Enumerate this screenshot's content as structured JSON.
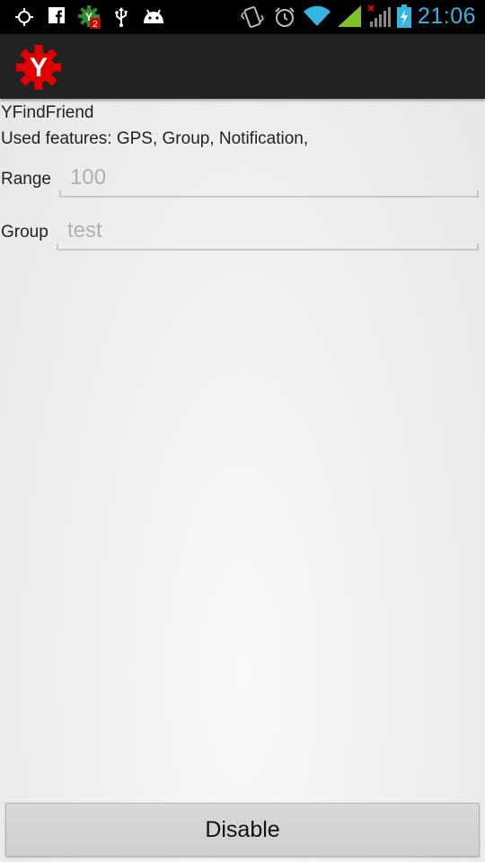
{
  "status_bar": {
    "left_icons": [
      "gps-icon",
      "facebook-icon",
      "app-notification-icon",
      "usb-icon",
      "android-debug-icon"
    ],
    "notification_badge": "2",
    "right_icons": [
      "vibrate-icon",
      "alarm-icon",
      "wifi-icon",
      "signal-icon",
      "signal-no-service-icon",
      "battery-charging-icon"
    ],
    "time": "21:06",
    "accent": "#33b5e5"
  },
  "action_bar": {
    "logo_icon": "app-logo-icon",
    "logo_letter": "Y",
    "logo_color": "#e00000"
  },
  "content": {
    "app_name": "YFindFriend",
    "features": "Used features: GPS, Group, Notification,",
    "range": {
      "label": "Range",
      "value": "100"
    },
    "group": {
      "label": "Group",
      "value": "test"
    }
  },
  "button": {
    "label": "Disable"
  }
}
